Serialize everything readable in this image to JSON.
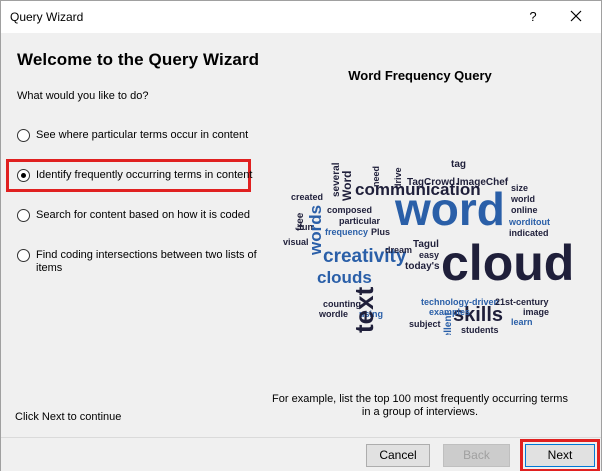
{
  "window": {
    "title": "Query Wizard",
    "help_label": "?",
    "close_icon": "close-icon"
  },
  "main": {
    "heading": "Welcome to the Query Wizard",
    "question": "What would you like to do?",
    "options": [
      {
        "label": "See where particular terms occur in content",
        "checked": false
      },
      {
        "label": "Identify frequently occurring terms in content",
        "checked": true
      },
      {
        "label": "Search for content based on how it is coded",
        "checked": false
      },
      {
        "label": "Find coding intersections between two lists of items",
        "checked": false
      }
    ],
    "click_next": "Click  Next to continue"
  },
  "preview": {
    "title": "Word Frequency Query",
    "caption": "For example, list the top 100 most frequently occurring terms in a group of interviews.",
    "cloud_colors": {
      "dark": "#1f1f3a",
      "blue": "#2a5fa8",
      "mid": "#3b6fb6"
    }
  },
  "footer": {
    "cancel_label": "Cancel",
    "back_label": "Back",
    "next_label": "Next"
  },
  "colors": {
    "highlight": "#e02020",
    "accent": "#0078d7"
  }
}
